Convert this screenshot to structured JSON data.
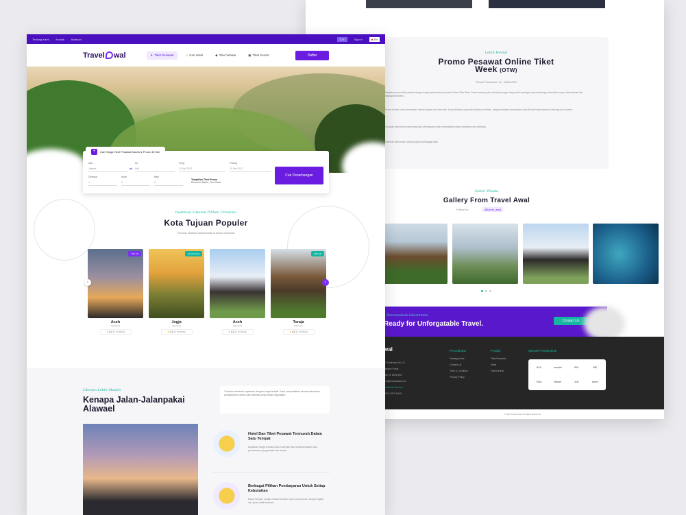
{
  "topbar": {
    "links": [
      "Tentang Kami",
      "Kontak",
      "Bantuan"
    ],
    "currency": "IDR",
    "signup": "Sign in",
    "language": "EN"
  },
  "nav": {
    "logo_text_1": "Travel",
    "logo_text_2": "wal",
    "items": [
      "Tiket Pesawat",
      "Cari Hotel",
      "Tiket Wisata",
      "Tiket Kereta"
    ],
    "login_button": "Daftar"
  },
  "search": {
    "tab_label": "Cari Harga Tiket Pesawat Murah & Promo Di Sini",
    "from_label": "Dari",
    "from_value": "Jakarta",
    "to_label": "Ke",
    "to_value": "Bali",
    "depart_label": "Pergi",
    "depart_value": "12 Mei 2022",
    "return_label": "Pulang",
    "return_value": "15 Mei 2022",
    "adult_label": "Dewasa",
    "child_label": "Anak",
    "infant_label": "Bayi",
    "adult_value": "1",
    "child_value": "0",
    "infant_value": "0",
    "cabin_label": "Pilih Kabin",
    "cabin_title": "Tampilkan Tiket Promo",
    "cabin_desc": "Ekonomi, Bisnis, First Class",
    "submit": "Cari Penerbangan"
  },
  "popular": {
    "subtitle": "Destinasi Liburan Pilihan Untukmu",
    "title": "Kota Tujuan Populer",
    "description": "Temukan destinasi wisata terbaik di seluruh Indonesia",
    "cards": [
      {
        "name": "Aceh",
        "sub": "Indonesia",
        "badge": "30% Off",
        "badge_color": "#7b2ff7",
        "rating": "4.2",
        "reviews": "(2 reviews)"
      },
      {
        "name": "Jogja",
        "sub": "Indonesia",
        "badge": "Special Deal",
        "badge_color": "#16b6a2",
        "rating": "4.2",
        "reviews": "(2 reviews)"
      },
      {
        "name": "Aceh",
        "sub": "Indonesia",
        "badge": "",
        "badge_color": "#7b2ff7",
        "rating": "4.2",
        "reviews": "(2 reviews)"
      },
      {
        "name": "Toraja",
        "sub": "Indonesia",
        "badge": "30% Off",
        "badge_color": "#16b6a2",
        "rating": "4.2",
        "reviews": "(2 reviews)"
      }
    ]
  },
  "why": {
    "subtitle": "Liburan Lebih Mudah",
    "title_1": "Kenapa Jalan-Jalanpakai",
    "title_2": "Alawael",
    "intro": "Temukan destinasi impianmu dengan harga terbaik. Kami menyediakan semua kebutuhan perjalananmu dalam satu aplikasi yang mudah digunakan.",
    "features": [
      {
        "title": "Hotel Dan Tiket Pesawat Termurah Dalam Satu Tempat",
        "desc": "Dapatkan harga terbaik untuk hotel dan tiket pesawat dalam satu pemesanan yang praktis dan hemat."
      },
      {
        "title": "Berbagai Pilihan Pembayaran Untuk Setiap Kebutuhan",
        "desc": "Bayar dengan mudah melalui transfer bank, kartu kredit, dompet digital dan gerai retail terdekat."
      }
    ]
  },
  "promo": {
    "subtitle": "Lebih Hemat",
    "title_1": "Promo Pesawat Online Tiket",
    "title_2": "Week",
    "title_tag": "(OTW)",
    "meta": "Periode Pemesanan: 12 - 18 Mei 2022",
    "paragraphs": [
      "Dapatkan promo tiket pesawat dengan harga spesial selama periode Online Tiket Week. Pesan sekarang dan nikmati potongan harga untuk berbagai rute penerbangan domestik maupun internasional dari maskapai favoritmu.",
      "Promo berlaku untuk pemesanan melalui aplikasi dan situs web. Kuota terbatas, syarat dan ketentuan berlaku. Jangan lewatkan kesempatan untuk liburan hemat bersama keluarga dan sahabat.",
      "Gunakan kode promo saat melakukan pembayaran untuk mendapatkan diskon tambahan dan cashback.",
      "Informasi lebih lanjut hubungi layanan pelanggan kami."
    ]
  },
  "gallery": {
    "subtitle": "Galeri Wisata",
    "title": "Gallery From Travel Awal",
    "follow_label": "Follow Us",
    "handle": "@travel_awal"
  },
  "cta": {
    "subtitle": "Rencanakan Liburanmu",
    "text": "Ready for Unforgatable Travel.",
    "button": "Contact Us"
  },
  "footer": {
    "logo": "wal",
    "col1": [
      "Jl. Sudirman No. 12",
      "Jakarta Pusat",
      "+62 21 5678 910",
      "info@travelawal.com",
      "Customer Service",
      "(021) 2970 6410"
    ],
    "company_title": "Perusahaan",
    "company_links": [
      "Tentang Kami",
      "Contact Us",
      "Term & Condition",
      "Privacy Policy"
    ],
    "product_title": "Produk",
    "product_links": [
      "Tiket Pesawat",
      "Hotel",
      "Tiket Kereta"
    ],
    "payment_title": "Metode Pembayaran",
    "payments": [
      "BCA",
      "mandiri",
      "BNI",
      "BRI",
      "VISA",
      "Master",
      "JCB",
      "Amex"
    ],
    "copyright": "© 2022 Travel Awal. All Rights Reserved."
  }
}
